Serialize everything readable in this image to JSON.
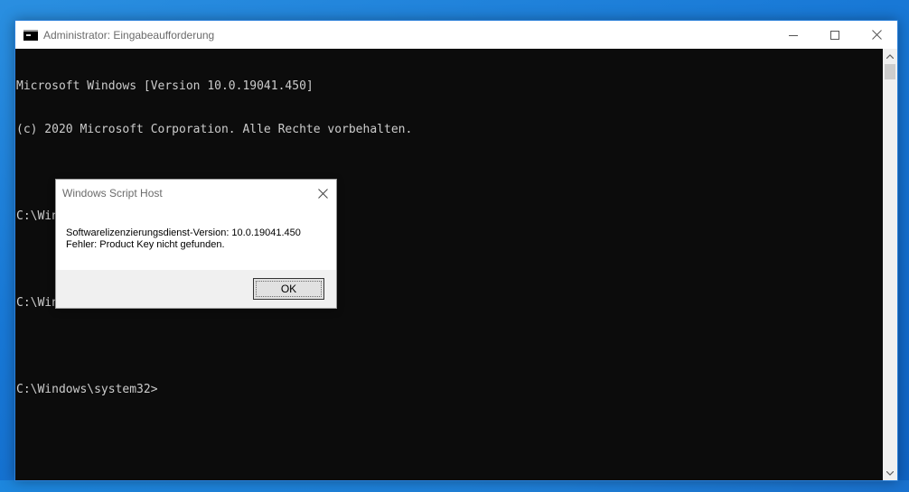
{
  "window": {
    "title": "Administrator: Eingabeaufforderung",
    "icon": "cmd-icon",
    "controls": {
      "minimize": "minimize-icon",
      "maximize": "maximize-icon",
      "close": "close-icon"
    }
  },
  "console": {
    "lines": [
      "Microsoft Windows [Version 10.0.19041.450]",
      "(c) 2020 Microsoft Corporation. Alle Rechte vorbehalten.",
      "",
      "C:\\Windows\\system32>slmgr.vbs /upk",
      "",
      "C:\\Windows\\system32>slmgr.vbs /DLV",
      "",
      "C:\\Windows\\system32>"
    ]
  },
  "dialog": {
    "title": "Windows Script Host",
    "message_line1": "Softwarelizenzierungsdienst-Version: 10.0.19041.450",
    "message_line2": "Fehler: Product Key nicht gefunden.",
    "ok_label": "OK"
  },
  "colors": {
    "console_bg": "#0c0c0c",
    "console_text": "#cccccc",
    "desktop_accent": "#1878d6"
  }
}
